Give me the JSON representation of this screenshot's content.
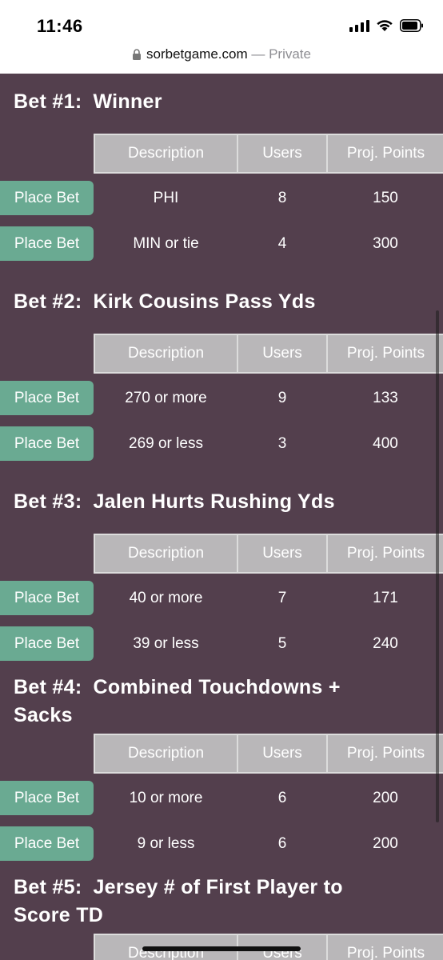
{
  "status": {
    "time": "11:46",
    "icons": [
      "cellular-signal-icon",
      "wifi-icon",
      "battery-icon"
    ]
  },
  "browser": {
    "domain": "sorbetgame.com",
    "separator": " — ",
    "mode": "Private"
  },
  "colors": {
    "background": "#533f4d",
    "button": "#6aaa92",
    "header": "#b9b7b9"
  },
  "table_headers": {
    "description": "Description",
    "users": "Users",
    "points": "Proj. Points"
  },
  "place_bet_label": "Place Bet",
  "bets": [
    {
      "number": "Bet #1:",
      "title": "Winner",
      "options": [
        {
          "description": "PHI",
          "users": "8",
          "points": "150"
        },
        {
          "description": "MIN or tie",
          "users": "4",
          "points": "300"
        }
      ]
    },
    {
      "number": "Bet #2:",
      "title": "Kirk Cousins Pass Yds",
      "options": [
        {
          "description": "270 or more",
          "users": "9",
          "points": "133"
        },
        {
          "description": "269 or less",
          "users": "3",
          "points": "400"
        }
      ]
    },
    {
      "number": "Bet #3:",
      "title": "Jalen Hurts Rushing Yds",
      "options": [
        {
          "description": "40 or more",
          "users": "7",
          "points": "171"
        },
        {
          "description": "39 or less",
          "users": "5",
          "points": "240"
        }
      ]
    },
    {
      "number": "Bet #4:",
      "title_line1": "Combined Touchdowns +",
      "title_line2": "Sacks",
      "options": [
        {
          "description": "10 or more",
          "users": "6",
          "points": "200"
        },
        {
          "description": "9 or less",
          "users": "6",
          "points": "200"
        }
      ]
    },
    {
      "number": "Bet #5:",
      "title_line1": "Jersey # of First Player to",
      "title_line2": "Score TD"
    }
  ]
}
